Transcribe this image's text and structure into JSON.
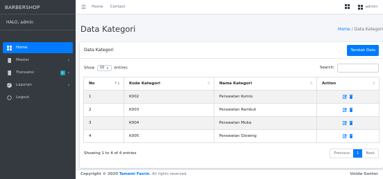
{
  "brand": "BARBERSHOP",
  "user": "HALO, admin",
  "sidebar": {
    "items": [
      {
        "label": "Home",
        "icon": "grid-icon"
      },
      {
        "label": "Master",
        "icon": "book-icon"
      },
      {
        "label": "Transaksi",
        "icon": "book-icon",
        "badge": "6"
      },
      {
        "label": "Laporan",
        "icon": "chart-pie-icon"
      },
      {
        "label": "Logout",
        "icon": "circle-icon"
      }
    ]
  },
  "topbar": {
    "nav1": "Home",
    "nav2": "Contact",
    "admin": "admin"
  },
  "page": {
    "title": "Data Kategori",
    "breadcrumb_home": "Home",
    "breadcrumb_sep": "/",
    "breadcrumb_current": "Data Kategori"
  },
  "card": {
    "title": "Data Kategori",
    "add_button": "Tambah Data",
    "show_label": "Show",
    "show_value": "10",
    "entries_label": "entries",
    "search_label": "Search:"
  },
  "table": {
    "headers": [
      "No",
      "Kode Kategori",
      "Nama Kategori",
      "Action"
    ],
    "rows": [
      [
        "1",
        "K002",
        "Perawatan Kumis"
      ],
      [
        "2",
        "K003",
        "Perawatan Rambut"
      ],
      [
        "3",
        "K004",
        "Perawatan Muka"
      ],
      [
        "4",
        "K005",
        "Perawatan Glowing"
      ]
    ]
  },
  "info": "Showing 1 to 4 of 4 entries",
  "pagination": {
    "prev": "Previous",
    "current": "1",
    "next": "Next"
  },
  "footer": {
    "copyright": "Copyright © 2020",
    "author": "Tamami Fazrin.",
    "rights": "All rights reserved.",
    "right_text": "Unida Gontor"
  },
  "colors": {
    "primary": "#007bff",
    "sidebar": "#343a40",
    "badge": "#17a2b8",
    "edit": "#007bff",
    "delete": "#007bff"
  }
}
